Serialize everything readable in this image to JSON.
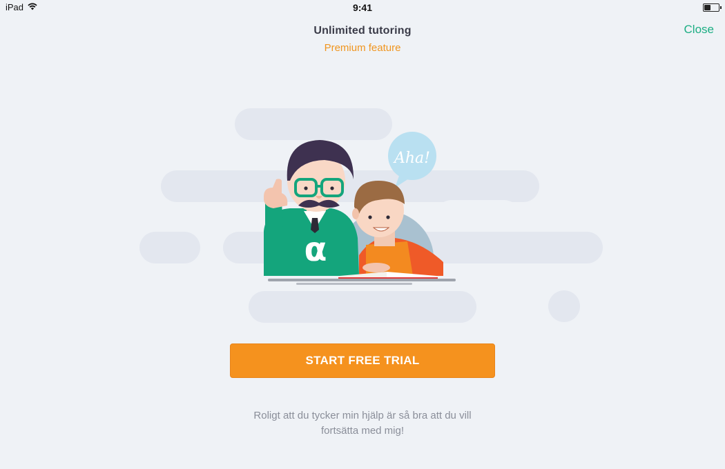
{
  "status_bar": {
    "device": "iPad",
    "time": "9:41",
    "icons": [
      "wifi-icon",
      "battery-icon"
    ]
  },
  "header": {
    "title": "Unlimited tutoring",
    "subtitle": "Premium feature",
    "close_label": "Close"
  },
  "illustration": {
    "speech_bubble": "Aha!",
    "shirt_symbol": "α"
  },
  "cta": {
    "label": "START FREE TRIAL"
  },
  "message": {
    "line1": "Roligt att du tycker min hjälp är så bra att du vill",
    "line2": "fortsätta med mig!"
  },
  "colors": {
    "background": "#eff2f6",
    "accent_orange": "#f5921e",
    "close_green": "#1cae83",
    "subtitle_orange": "#f0951e",
    "tutor_green": "#14a57c"
  }
}
